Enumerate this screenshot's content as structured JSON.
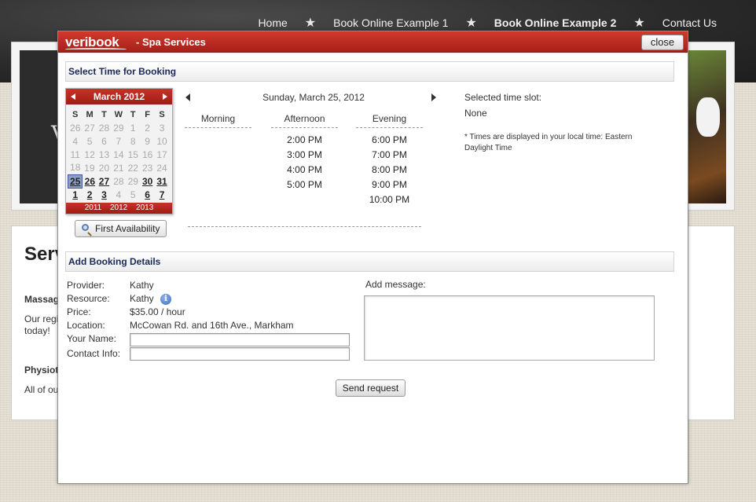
{
  "nav": {
    "items": [
      {
        "label": "Home",
        "active": false
      },
      {
        "label": "Book Online Example 1",
        "active": false
      },
      {
        "label": "Book Online Example 2",
        "active": true
      },
      {
        "label": "Contact Us",
        "active": false
      }
    ],
    "separator": "★"
  },
  "background_page": {
    "title": "Serv",
    "section1_heading": "Massag",
    "section1_text": "Our regi today!",
    "section2_heading": "Physiot",
    "section2_text": "All of ou",
    "banner_letter": "V"
  },
  "modal": {
    "logo": "veribook",
    "title": "- Spa Services",
    "close_label": "close",
    "colors": {
      "header": "#b7281f",
      "section_text": "#1a2a55"
    },
    "section_time": "Select Time for Booking",
    "section_details": "Add Booking Details",
    "calendar": {
      "month_label": "March 2012",
      "weekdays": [
        "S",
        "M",
        "T",
        "W",
        "T",
        "F",
        "S"
      ],
      "weeks": [
        [
          {
            "d": "26",
            "s": "other"
          },
          {
            "d": "27",
            "s": "other"
          },
          {
            "d": "28",
            "s": "other"
          },
          {
            "d": "29",
            "s": "other"
          },
          {
            "d": "1",
            "s": "off"
          },
          {
            "d": "2",
            "s": "off"
          },
          {
            "d": "3",
            "s": "off"
          }
        ],
        [
          {
            "d": "4",
            "s": "off"
          },
          {
            "d": "5",
            "s": "off"
          },
          {
            "d": "6",
            "s": "off"
          },
          {
            "d": "7",
            "s": "off"
          },
          {
            "d": "8",
            "s": "off"
          },
          {
            "d": "9",
            "s": "off"
          },
          {
            "d": "10",
            "s": "off"
          }
        ],
        [
          {
            "d": "11",
            "s": "off"
          },
          {
            "d": "12",
            "s": "off"
          },
          {
            "d": "13",
            "s": "off"
          },
          {
            "d": "14",
            "s": "off"
          },
          {
            "d": "15",
            "s": "off"
          },
          {
            "d": "16",
            "s": "off"
          },
          {
            "d": "17",
            "s": "off"
          }
        ],
        [
          {
            "d": "18",
            "s": "off"
          },
          {
            "d": "19",
            "s": "off"
          },
          {
            "d": "20",
            "s": "off"
          },
          {
            "d": "21",
            "s": "off"
          },
          {
            "d": "22",
            "s": "off"
          },
          {
            "d": "23",
            "s": "off"
          },
          {
            "d": "24",
            "s": "off"
          }
        ],
        [
          {
            "d": "25",
            "s": "selected"
          },
          {
            "d": "26",
            "s": "avail"
          },
          {
            "d": "27",
            "s": "avail"
          },
          {
            "d": "28",
            "s": "off"
          },
          {
            "d": "29",
            "s": "off"
          },
          {
            "d": "30",
            "s": "avail"
          },
          {
            "d": "31",
            "s": "avail"
          }
        ],
        [
          {
            "d": "1",
            "s": "avail"
          },
          {
            "d": "2",
            "s": "avail"
          },
          {
            "d": "3",
            "s": "avail"
          },
          {
            "d": "4",
            "s": "off"
          },
          {
            "d": "5",
            "s": "off"
          },
          {
            "d": "6",
            "s": "avail"
          },
          {
            "d": "7",
            "s": "avail"
          }
        ]
      ],
      "years": [
        "2011",
        "2012",
        "2013"
      ]
    },
    "first_availability_label": "First Availability",
    "day_label": "Sunday, March 25, 2012",
    "columns": {
      "morning": {
        "label": "Morning",
        "slots": []
      },
      "afternoon": {
        "label": "Afternoon",
        "slots": [
          "2:00 PM",
          "3:00 PM",
          "4:00 PM",
          "5:00 PM"
        ]
      },
      "evening": {
        "label": "Evening",
        "slots": [
          "6:00 PM",
          "7:00 PM",
          "8:00 PM",
          "9:00 PM",
          "10:00 PM"
        ]
      }
    },
    "selected_slot_label": "Selected time slot:",
    "selected_slot_value": "None",
    "timezone_note": "* Times are displayed in your local time: Eastern Daylight Time",
    "details": {
      "provider_label": "Provider:",
      "provider": "Kathy",
      "resource_label": "Resource:",
      "resource": "Kathy",
      "price_label": "Price:",
      "price": "$35.00 / hour",
      "location_label": "Location:",
      "location": "McCowan Rd. and 16th Ave., Markham",
      "name_label": "Your Name:",
      "name_value": "",
      "contact_label": "Contact Info:",
      "contact_value": "",
      "message_label": "Add message:",
      "message_value": ""
    },
    "send_label": "Send request"
  }
}
